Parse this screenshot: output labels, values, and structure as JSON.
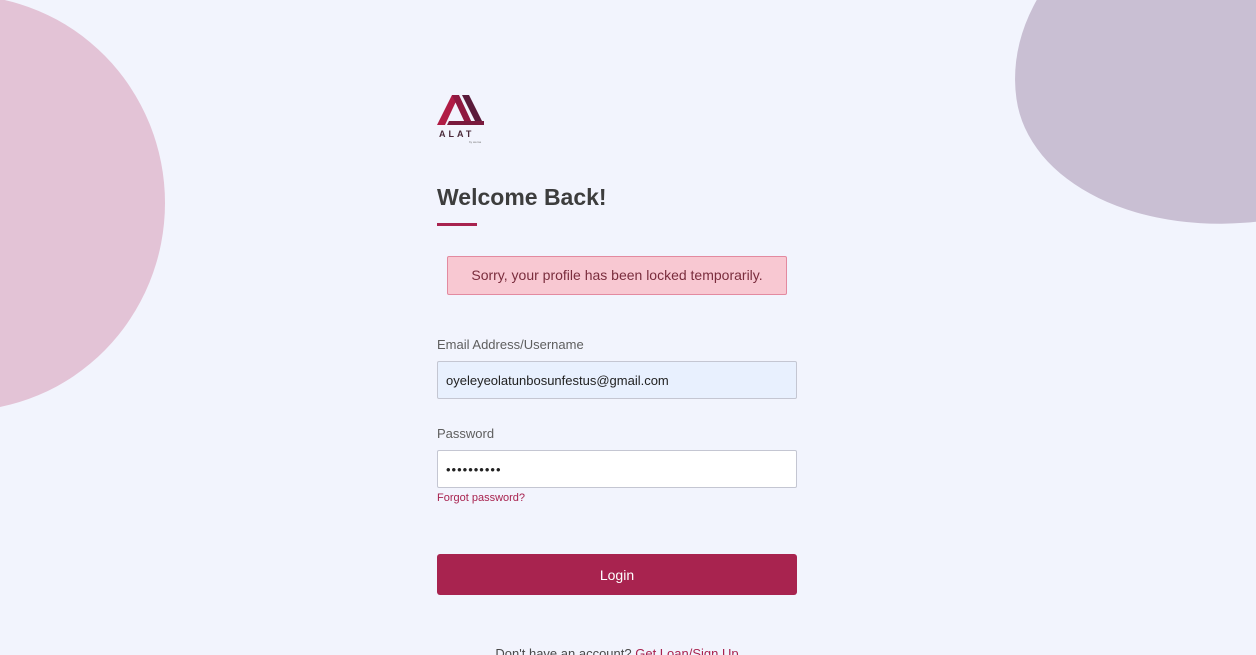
{
  "brand": {
    "logo_icon": "alat-logo-icon",
    "wordmark": "ALAT",
    "subtext": "by wema",
    "accent_color": "#a8234f"
  },
  "heading": {
    "title": "Welcome Back!"
  },
  "alert": {
    "message": "Sorry, your profile has been locked temporarily."
  },
  "form": {
    "email_label": "Email Address/Username",
    "email_value": "oyeleyeolatunbosunfestus@gmail.com",
    "password_label": "Password",
    "password_value": "••••••••••",
    "forgot_password": "Forgot password?",
    "login_button": "Login"
  },
  "footer": {
    "prompt": "Don't have an account?",
    "signup_link": "Get Loan/Sign Up"
  }
}
